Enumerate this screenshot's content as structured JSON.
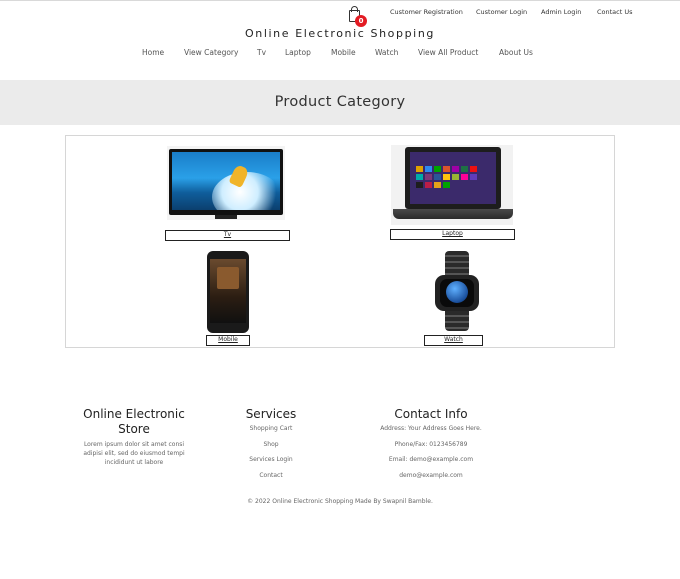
{
  "header": {
    "cart_count": "0",
    "top_links": [
      "Customer Registration",
      "Customer Login",
      "Admin Login",
      "Contact Us"
    ],
    "brand": "Online Electronic Shopping",
    "nav": [
      "Home",
      "View Category",
      "Tv",
      "Laptop",
      "Mobile",
      "Watch",
      "View All Product",
      "About Us"
    ]
  },
  "banner": {
    "title": "Product Category"
  },
  "categories": [
    {
      "label": "Tv",
      "image": "tv-image"
    },
    {
      "label": "Laptop",
      "image": "laptop-image"
    },
    {
      "label": "Mobile",
      "image": "mobile-image"
    },
    {
      "label": "Watch",
      "image": "watch-image"
    }
  ],
  "footer": {
    "store": {
      "title": "Online Electronic Store",
      "text": "Lorem ipsum dolor sit amet consi adipisi elit, sed do eiusmod tempi incididunt ut labore"
    },
    "services": {
      "title": "Services",
      "items": [
        "Shopping Cart",
        "Shop",
        "Services Login",
        "Contact"
      ]
    },
    "contact": {
      "title": "Contact Info",
      "items": [
        "Address: Your Address Goes Here.",
        "Phone/Fax: 0123456789",
        "Email: demo@example.com",
        "demo@example.com"
      ]
    },
    "copyright": "© 2022 Online Electronic Shopping Made By Swapnil Bamble."
  },
  "colors": {
    "badge": "#e31b23",
    "banner_bg": "#ebebeb"
  }
}
